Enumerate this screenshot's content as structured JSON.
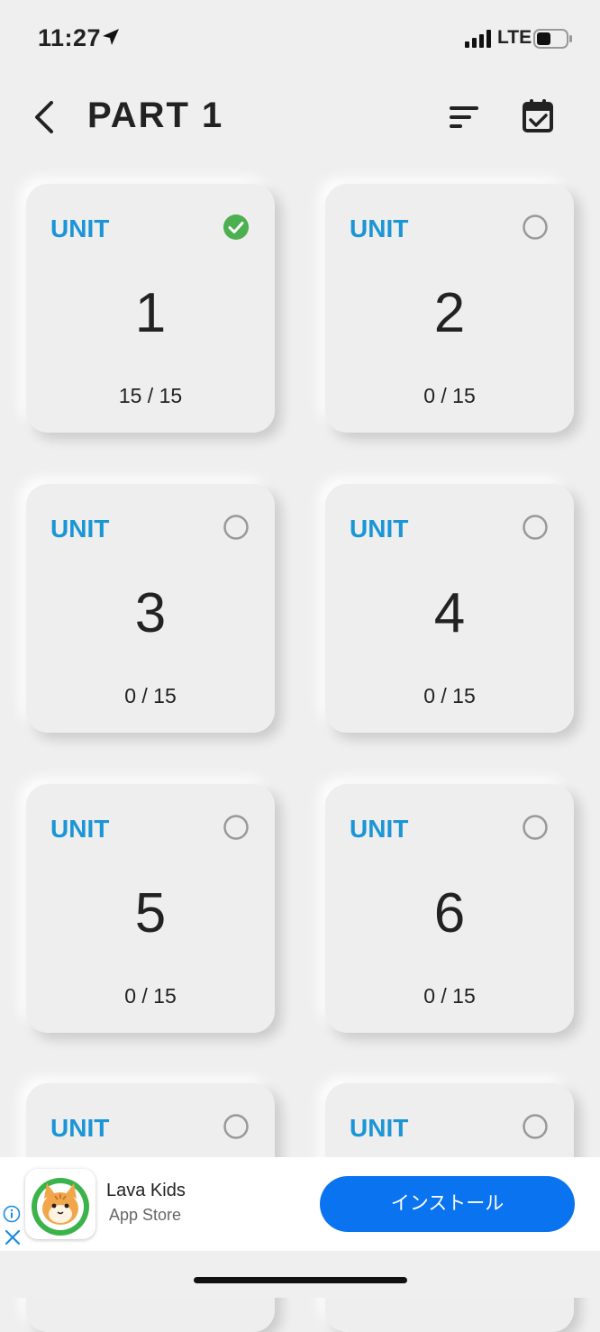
{
  "status_bar": {
    "time": "11:27",
    "network": "LTE",
    "icons": [
      "location-arrow-icon",
      "signal-bars-icon",
      "battery-icon"
    ]
  },
  "header": {
    "title": "PART 1",
    "back_icon": "chevron-left-icon",
    "sort_icon": "sort-icon",
    "calendar_icon": "calendar-check-icon"
  },
  "units": [
    {
      "label": "UNIT",
      "number": "1",
      "progress": "15 / 15",
      "completed": true
    },
    {
      "label": "UNIT",
      "number": "2",
      "progress": "0 / 15",
      "completed": false
    },
    {
      "label": "UNIT",
      "number": "3",
      "progress": "0 / 15",
      "completed": false
    },
    {
      "label": "UNIT",
      "number": "4",
      "progress": "0 / 15",
      "completed": false
    },
    {
      "label": "UNIT",
      "number": "5",
      "progress": "0 / 15",
      "completed": false
    },
    {
      "label": "UNIT",
      "number": "6",
      "progress": "0 / 15",
      "completed": false
    },
    {
      "label": "UNIT",
      "number": "",
      "progress": "",
      "completed": false
    },
    {
      "label": "UNIT",
      "number": "",
      "progress": "",
      "completed": false
    }
  ],
  "ad": {
    "app_name": "Lava Kids",
    "store": "App Store",
    "install_label": "インストール",
    "info_icon": "info-icon",
    "close_icon": "close-icon"
  },
  "colors": {
    "background": "#efefef",
    "accent": "#1a95d6",
    "complete": "#4caf50",
    "install_button": "#0a74f0"
  }
}
